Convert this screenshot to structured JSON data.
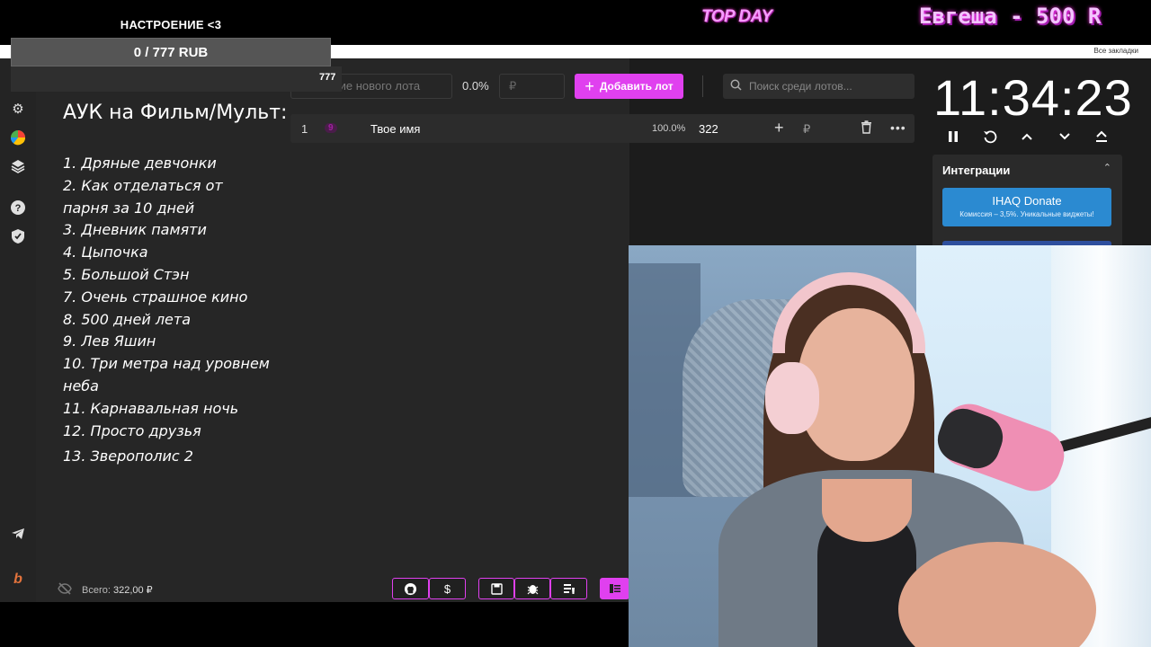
{
  "overlay": {
    "goal_title": "НАСТРОЕНИЕ <3",
    "goal_progress": "0 / 777 RUB",
    "goal_mark": "777",
    "topday": "TOP DAY",
    "banner": "Евгеша - 500 R"
  },
  "browser": {
    "bookmarks": "Все закладки"
  },
  "sidebar": {
    "items": [
      "auction-icon",
      "gear-icon",
      "pie-chart-icon",
      "layers-icon",
      "help-icon",
      "shield-icon",
      "telegram-icon",
      "brand-icon"
    ]
  },
  "list_panel": {
    "title": "АУК на Фильм/Мульт:",
    "films": [
      "1. Дряные девчонки",
      "2. Как отделаться от парня за 10 дней",
      "3. Дневник памяти",
      "4. Цыпочка",
      "5. Большой Стэн",
      "7. Очень страшное кино",
      "8. 500 дней лета",
      "9. Лев Яшин",
      "10. Три метра над уровнем неба",
      "11. Карнавальная ночь",
      "12. Просто друзья",
      "13. Зверополис 2"
    ]
  },
  "toolbar": {
    "lot_placeholder": "Название нового лота",
    "percent": "0.0%",
    "currency_placeholder": "₽",
    "add_label": "Добавить лот",
    "search_placeholder": "Поиск среди лотов..."
  },
  "lots": [
    {
      "num": "1",
      "badge": "9",
      "name": "Твое имя",
      "percent": "100.0%",
      "amount": "322",
      "currency": "₽"
    }
  ],
  "timer": {
    "value": "11:34:23"
  },
  "integrations": {
    "title": "Интеграции",
    "donate_name": "IHAQ Donate",
    "donate_sub": "Комиссия – 3,5%. Уникальные виджеты!"
  },
  "footer": {
    "total_label": "Всего:",
    "total_value": "322,00 ₽"
  },
  "colors": {
    "accent": "#e040ef",
    "donate": "#2b8ad1",
    "background": "#1c1c1c"
  }
}
